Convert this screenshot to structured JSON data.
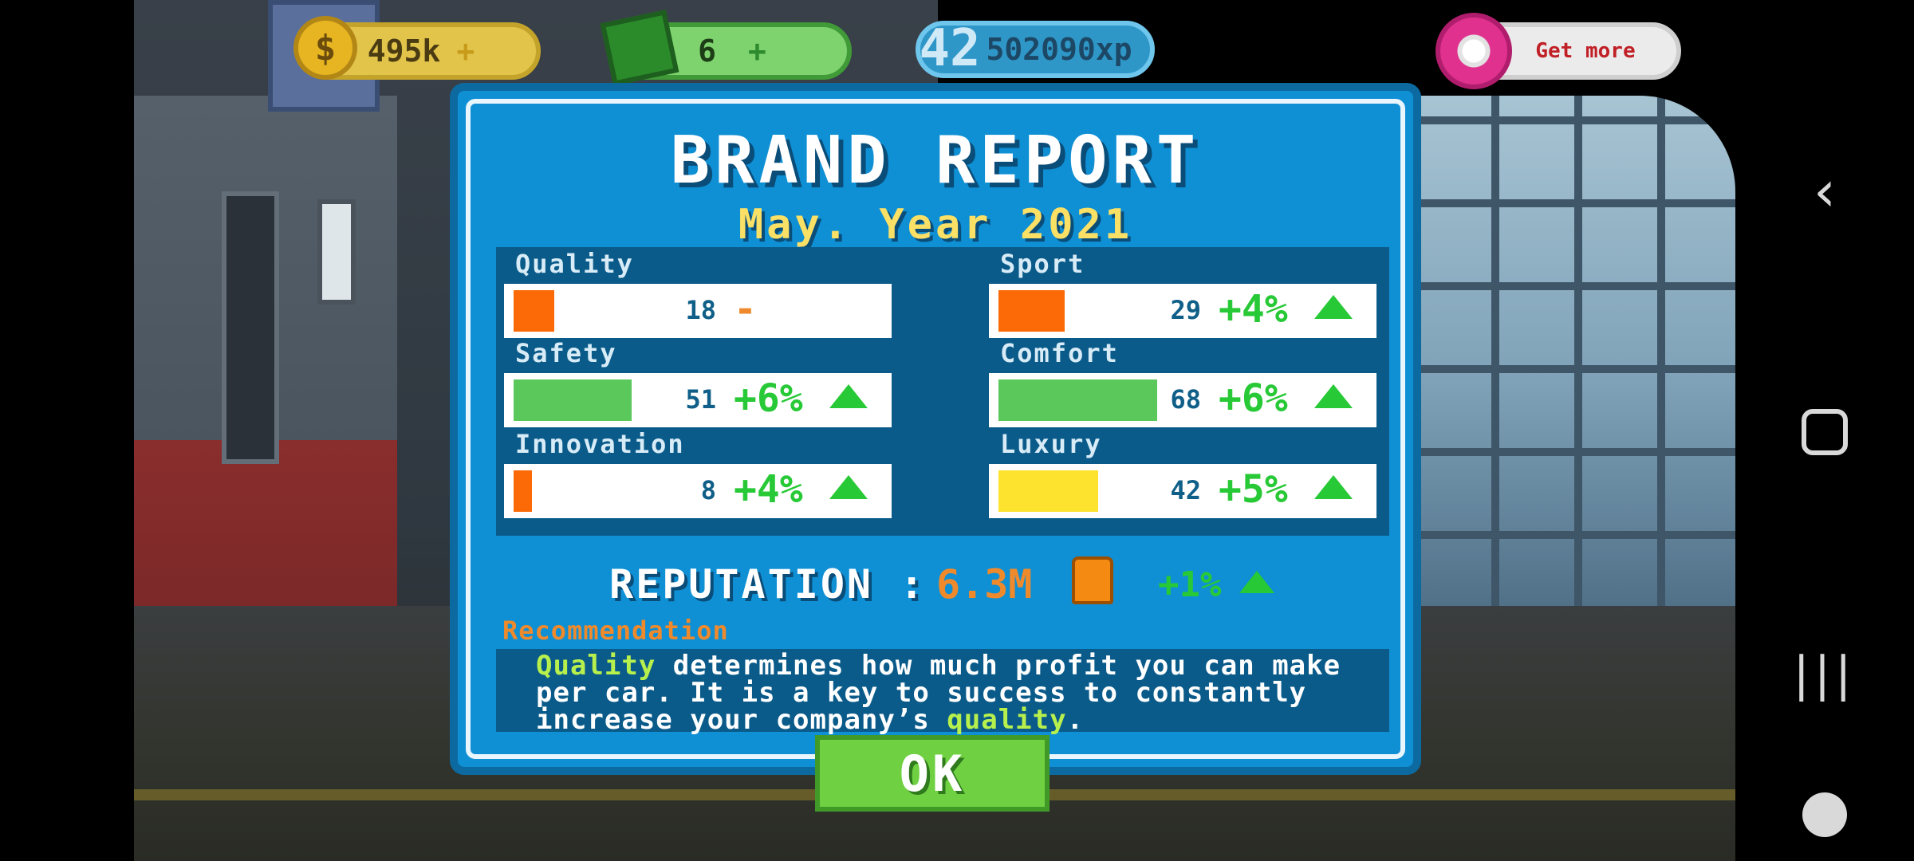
{
  "hud": {
    "coins": "495k",
    "coins_plus": "+",
    "cash": "6",
    "cash_plus": "+",
    "level": "42",
    "xp": "502090xp",
    "get_more": "Get more"
  },
  "dialog": {
    "title": "BRAND REPORT",
    "subtitle": "May. Year 2021",
    "stats": [
      {
        "label": "Quality",
        "value": "18",
        "change": "-",
        "fill": 0.11,
        "color": "#fb6a07"
      },
      {
        "label": "Sport",
        "value": "29",
        "change": "+4%",
        "fill": 0.18,
        "color": "#fb6a07"
      },
      {
        "label": "Safety",
        "value": "51",
        "change": "+6%",
        "fill": 0.32,
        "color": "#5ac85a"
      },
      {
        "label": "Comfort",
        "value": "68",
        "change": "+6%",
        "fill": 0.43,
        "color": "#5ac85a"
      },
      {
        "label": "Innovation",
        "value": "8",
        "change": "+4%",
        "fill": 0.05,
        "color": "#fb6a07"
      },
      {
        "label": "Luxury",
        "value": "42",
        "change": "+5%",
        "fill": 0.27,
        "color": "#fde22e"
      }
    ],
    "reputation_label": "REPUTATION :",
    "reputation_value": "6.3M",
    "reputation_change": "+1%",
    "recommendation_title": "Recommendation",
    "recommendation": {
      "word1": "Quality",
      "part1": " determines how much profit you can make per car. It is a key to success to constantly increase your company’s ",
      "word2": "quality",
      "part2": "."
    },
    "ok_label": "OK"
  },
  "nav": {
    "back": "‹",
    "recent": "|||"
  },
  "colors": {
    "dialog_bg": "#0f8fd4",
    "panel_bg": "#0a5b8a",
    "positive": "#28c936",
    "warning": "#ef8a2c"
  },
  "icons": [
    "coin-icon",
    "cash-icon",
    "xp-plane-icon",
    "donut-icon",
    "thumbs-up-icon",
    "up-arrow-icon",
    "back-icon",
    "home-icon",
    "recent-apps-icon",
    "game-tools-icon"
  ]
}
